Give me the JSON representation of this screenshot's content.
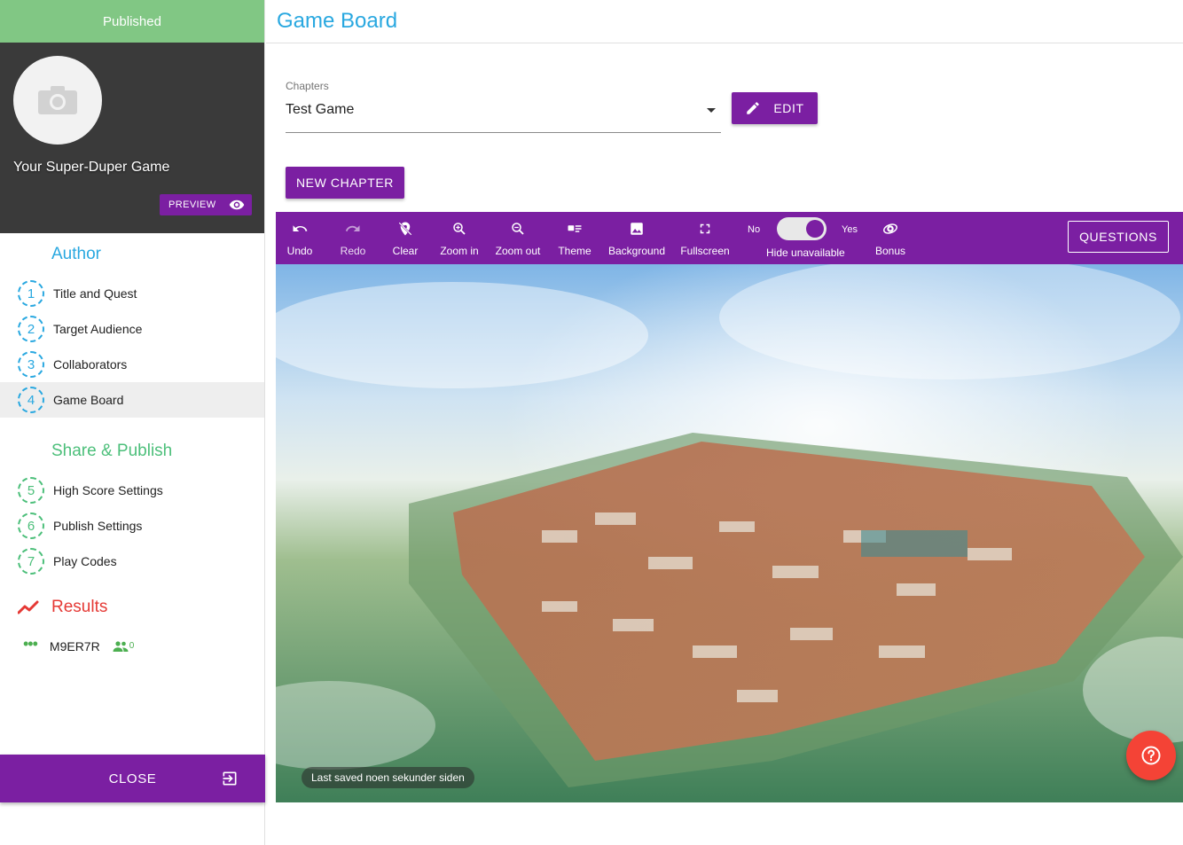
{
  "sidebar": {
    "status": "Published",
    "game_title": "Your Super-Duper Game",
    "preview_label": "PREVIEW",
    "author": {
      "title": "Author",
      "steps": [
        {
          "num": "1",
          "label": "Title and Quest"
        },
        {
          "num": "2",
          "label": "Target Audience"
        },
        {
          "num": "3",
          "label": "Collaborators"
        },
        {
          "num": "4",
          "label": "Game Board",
          "active": true
        }
      ]
    },
    "share": {
      "title": "Share & Publish",
      "steps": [
        {
          "num": "5",
          "label": "High Score Settings"
        },
        {
          "num": "6",
          "label": "Publish Settings"
        },
        {
          "num": "7",
          "label": "Play Codes"
        }
      ]
    },
    "results": {
      "title": "Results",
      "code": "M9ER7R",
      "player_count": "0"
    },
    "close_label": "CLOSE"
  },
  "main": {
    "page_title": "Game Board",
    "chapters": {
      "label": "Chapters",
      "selected": "Test Game"
    },
    "edit_label": "EDIT",
    "new_chapter_label": "NEW CHAPTER",
    "toolbar": {
      "tools": [
        {
          "label": "Undo",
          "icon": "undo-icon"
        },
        {
          "label": "Redo",
          "icon": "redo-icon"
        },
        {
          "label": "Clear",
          "icon": "clear-icon"
        },
        {
          "label": "Zoom in",
          "icon": "zoom-in-icon"
        },
        {
          "label": "Zoom out",
          "icon": "zoom-out-icon"
        },
        {
          "label": "Theme",
          "icon": "theme-icon"
        },
        {
          "label": "Background",
          "icon": "image-icon"
        },
        {
          "label": "Fullscreen",
          "icon": "fullscreen-icon"
        },
        {
          "label": "Bonus",
          "icon": "bonus-icon"
        }
      ],
      "toggle": {
        "no": "No",
        "yes": "Yes",
        "caption": "Hide unavailable",
        "on": true
      },
      "questions_label": "QUESTIONS"
    },
    "saved_status": "Last saved noen sekunder siden"
  },
  "colors": {
    "accent_purple": "#7b1fa2",
    "published_green": "#81c784",
    "author_blue": "#29a8e0",
    "share_green": "#4cbf7a",
    "results_red": "#e53935",
    "help_red": "#f44336"
  }
}
